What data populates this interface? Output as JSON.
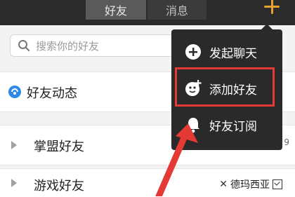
{
  "header": {
    "tabs": [
      {
        "label": "好友"
      },
      {
        "label": "消息"
      }
    ],
    "add_icon": "plus-icon",
    "accent_color": "#e6a12f"
  },
  "search": {
    "placeholder": "搜索你的好友",
    "icon": "search-icon"
  },
  "list": {
    "feed": {
      "label": "好友动态",
      "icon": "feed-icon"
    },
    "groups": [
      {
        "label": "掌盟好友",
        "right_fragment": "9"
      },
      {
        "label": "游戏好友",
        "region": "德玛西亚"
      }
    ]
  },
  "popup": {
    "items": [
      {
        "label": "发起聊天",
        "icon": "plus-circle-icon"
      },
      {
        "label": "添加好友",
        "icon": "add-friend-icon"
      },
      {
        "label": "好友订阅",
        "icon": "bell-icon"
      }
    ],
    "highlight_color": "#e53935"
  }
}
